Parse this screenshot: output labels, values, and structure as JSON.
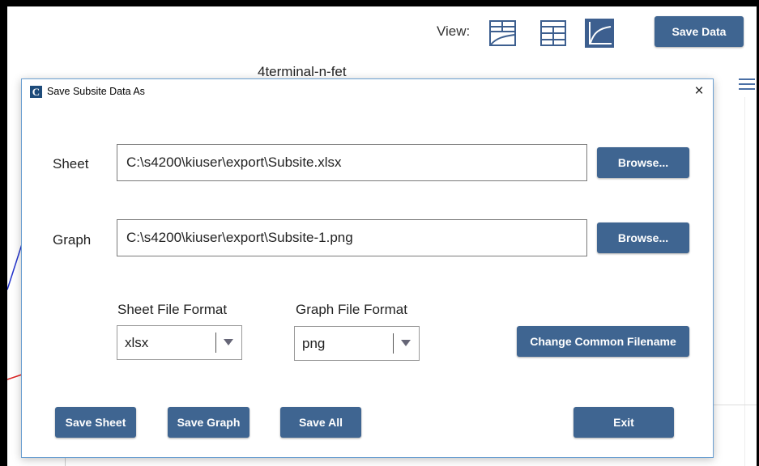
{
  "toolbar": {
    "view_label": "View:",
    "save_data_label": "Save Data",
    "views": [
      {
        "icon": "split-view-icon",
        "active": false
      },
      {
        "icon": "grid-view-icon",
        "active": false
      },
      {
        "icon": "graph-view-icon",
        "active": true
      }
    ]
  },
  "chart": {
    "title": "4terminal-n-fet"
  },
  "dialog": {
    "title": "Save Subsite Data As",
    "close_glyph": "×",
    "app_icon_letter": "C",
    "sheet": {
      "label": "Sheet",
      "value": "C:\\s4200\\kiuser\\export\\Subsite.xlsx",
      "browse_label": "Browse..."
    },
    "graph": {
      "label": "Graph",
      "value": "C:\\s4200\\kiuser\\export\\Subsite-1.png",
      "browse_label": "Browse..."
    },
    "sheet_format": {
      "label": "Sheet File Format",
      "selected": "xlsx"
    },
    "graph_format": {
      "label": "Graph File Format",
      "selected": "png"
    },
    "change_common_filename_label": "Change Common Filename",
    "buttons": {
      "save_sheet": "Save Sheet",
      "save_graph": "Save Graph",
      "save_all": "Save All",
      "exit": "Exit"
    }
  },
  "colors": {
    "button_bg": "#3f6591",
    "active_view_bg": "#3d5f8f",
    "dialog_border": "#6b9fd1",
    "icon_stroke": "#3d5f8f"
  }
}
